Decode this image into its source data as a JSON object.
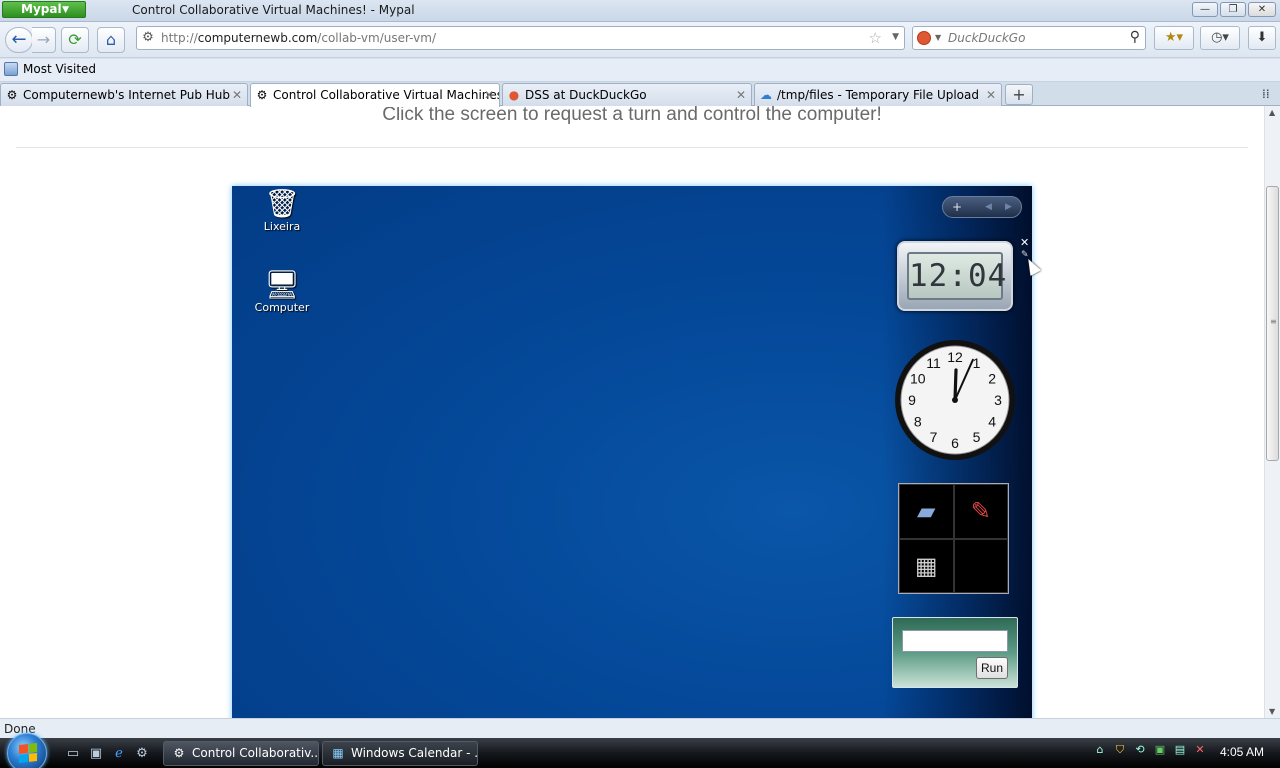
{
  "browser": {
    "app_menu_label": "Mypal",
    "window_title": "Control Collaborative Virtual Machines! - Mypal",
    "window_buttons": {
      "minimize": "—",
      "restore": "❐",
      "close": "✕"
    },
    "url_prefix": "http://",
    "url_domain": "computernewb.com",
    "url_path": "/collab-vm/user-vm/",
    "search_placeholder": "DuckDuckGo",
    "bookmarks": [
      {
        "label": "Most Visited"
      }
    ],
    "tabs": [
      {
        "label": "Computernewb's Internet Pub Hub",
        "active": false
      },
      {
        "label": "Control Collaborative Virtual Machines!",
        "active": true
      },
      {
        "label": "DSS at DuckDuckGo",
        "active": false
      },
      {
        "label": "/tmp/files - Temporary File Upload",
        "active": false
      }
    ],
    "status": "Done"
  },
  "page": {
    "instruction": "Click the screen to request a turn and control the computer!"
  },
  "vm": {
    "desktop_icons": [
      {
        "label": "Lixeira",
        "icon": "recycle-bin-icon"
      },
      {
        "label": "Computer",
        "icon": "computer-icon"
      }
    ],
    "digital_clock": "12:04",
    "analog_clock": {
      "hour": 12,
      "minute": 4,
      "numbers": [
        "12",
        "1",
        "2",
        "3",
        "4",
        "5",
        "6",
        "7",
        "8",
        "9",
        "10",
        "11"
      ]
    },
    "run_button": "Run"
  },
  "taskbar": {
    "tasks": [
      {
        "label": "Control Collaborativ...",
        "active": true
      },
      {
        "label": "Windows Calendar - ...",
        "active": false
      }
    ],
    "time": "4:05 AM"
  },
  "colors": {
    "desktop_blue": "#044899",
    "mypal_green": "#3fa02f"
  }
}
